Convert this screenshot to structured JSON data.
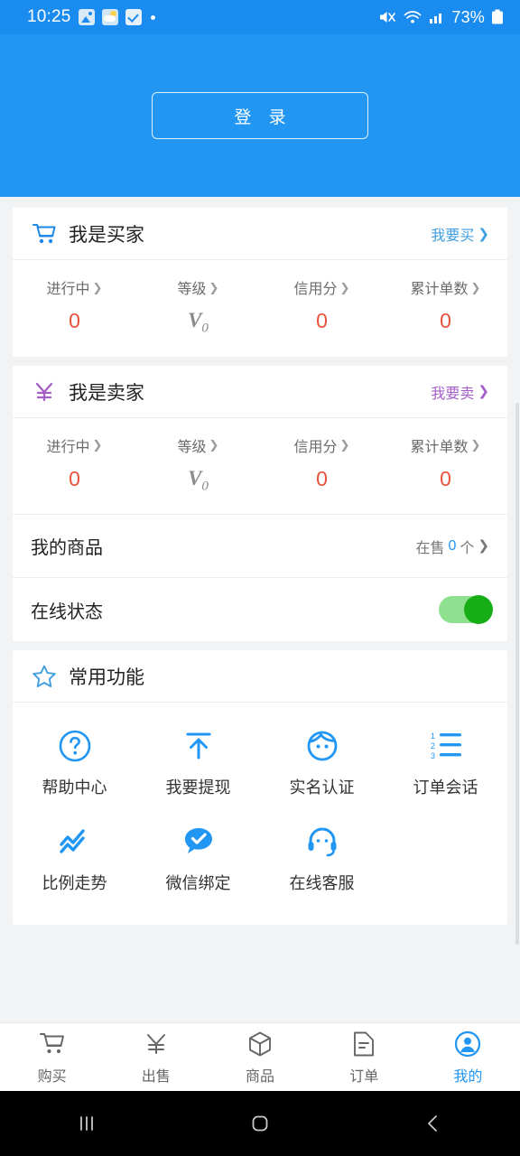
{
  "status_bar": {
    "time": "10:25",
    "battery": "73%",
    "icons": [
      "photo-icon",
      "weather-cloud-icon",
      "checkbox-icon",
      "dot-icon",
      "mute-icon",
      "wifi-icon",
      "signal-icon",
      "battery-icon"
    ]
  },
  "hero": {
    "login_label": "登 录"
  },
  "buyer_card": {
    "icon": "shopping-cart-icon",
    "title": "我是买家",
    "link_label": "我要买",
    "link_color": "#3f9fe0",
    "stats": [
      {
        "label": "进行中",
        "value": "0",
        "type": "number"
      },
      {
        "label": "等级",
        "value": "V",
        "sub": "0",
        "type": "level"
      },
      {
        "label": "信用分",
        "value": "0",
        "type": "number"
      },
      {
        "label": "累计单数",
        "value": "0",
        "type": "number"
      }
    ]
  },
  "seller_card": {
    "icon": "yen-icon",
    "title": "我是卖家",
    "link_label": "我要卖",
    "link_color": "#a45ec8",
    "stats": [
      {
        "label": "进行中",
        "value": "0",
        "type": "number"
      },
      {
        "label": "等级",
        "value": "V",
        "sub": "0",
        "type": "level"
      },
      {
        "label": "信用分",
        "value": "0",
        "type": "number"
      },
      {
        "label": "累计单数",
        "value": "0",
        "type": "number"
      }
    ],
    "my_goods": {
      "label": "我的商品",
      "prefix": "在售",
      "count": "0",
      "suffix": "个"
    },
    "online_status": {
      "label": "在线状态",
      "enabled": true
    }
  },
  "functions_card": {
    "icon": "star-icon",
    "title": "常用功能",
    "items": [
      {
        "label": "帮助中心",
        "icon": "question-circle-icon"
      },
      {
        "label": "我要提现",
        "icon": "withdraw-arrow-up-icon"
      },
      {
        "label": "实名认证",
        "icon": "face-id-icon"
      },
      {
        "label": "订单会话",
        "icon": "numbered-list-icon"
      },
      {
        "label": "比例走势",
        "icon": "trend-chart-icon"
      },
      {
        "label": "微信绑定",
        "icon": "wechat-check-bubble-icon"
      },
      {
        "label": "在线客服",
        "icon": "headset-support-icon"
      }
    ]
  },
  "tab_bar": {
    "active_color": "#2196f3",
    "tabs": [
      {
        "label": "购买",
        "icon": "cart-icon",
        "active": false
      },
      {
        "label": "出售",
        "icon": "yen-icon",
        "active": false
      },
      {
        "label": "商品",
        "icon": "box-icon",
        "active": false
      },
      {
        "label": "订单",
        "icon": "document-icon",
        "active": false
      },
      {
        "label": "我的",
        "icon": "person-circle-icon",
        "active": true
      }
    ]
  },
  "android_nav": {
    "buttons": [
      "recent-apps-icon",
      "home-icon",
      "back-icon"
    ]
  }
}
